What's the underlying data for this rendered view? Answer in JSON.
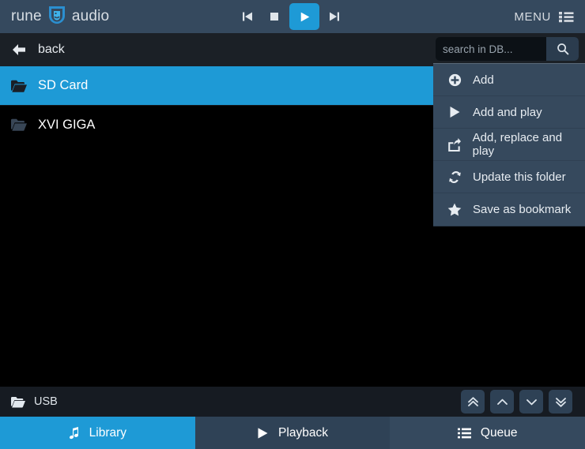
{
  "header": {
    "brand_left": "rune",
    "brand_right": "audio",
    "logo_icon": "runeaudio-logo-icon",
    "transport": {
      "prev_icon": "previous-track-icon",
      "stop_icon": "stop-icon",
      "play_icon": "play-icon",
      "next_icon": "next-track-icon"
    },
    "menu_label": "MENU",
    "menu_icon": "list-menu-icon"
  },
  "backbar": {
    "back_icon": "arrow-left-icon",
    "back_label": "back"
  },
  "search": {
    "placeholder": "search in DB...",
    "value": "",
    "button_icon": "search-icon"
  },
  "filelist": [
    {
      "label": "SD Card",
      "icon": "folder-open-icon",
      "selected": true
    },
    {
      "label": "XVI GIGA",
      "icon": "folder-open-icon",
      "selected": false
    }
  ],
  "dropdown": [
    {
      "label": "Add",
      "icon": "plus-circle-icon"
    },
    {
      "label": "Add and play",
      "icon": "play-icon"
    },
    {
      "label": "Add, replace and play",
      "icon": "share-arrow-icon"
    },
    {
      "label": "Update this folder",
      "icon": "refresh-icon"
    },
    {
      "label": "Save as bookmark",
      "icon": "star-icon"
    }
  ],
  "footer": {
    "location_icon": "folder-open-icon",
    "location_label": "USB",
    "scrollers": [
      {
        "name": "scroll-top-button",
        "icon": "chevron-double-up-icon"
      },
      {
        "name": "scroll-up-button",
        "icon": "chevron-up-icon"
      },
      {
        "name": "scroll-down-button",
        "icon": "chevron-down-icon"
      },
      {
        "name": "scroll-bottom-button",
        "icon": "chevron-double-down-icon"
      }
    ]
  },
  "tabs": [
    {
      "label": "Library",
      "icon": "music-note-icon",
      "active": true
    },
    {
      "label": "Playback",
      "icon": "play-icon",
      "active": false
    },
    {
      "label": "Queue",
      "icon": "list-icon",
      "active": false
    }
  ],
  "colors": {
    "accent": "#1e9ad6",
    "header_bg": "#35495e",
    "backbar_bg": "#1b2026",
    "body_bg": "#000000",
    "menu_bg": "#36495d",
    "footer_bg": "#161b22"
  }
}
